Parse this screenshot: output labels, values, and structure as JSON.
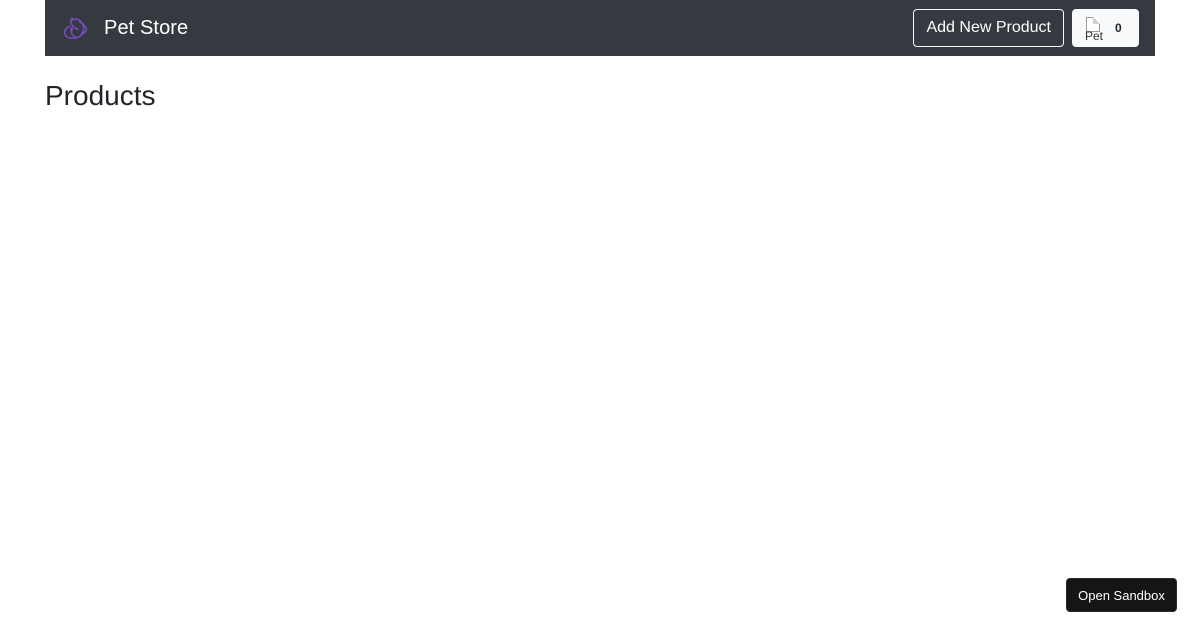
{
  "navbar": {
    "brand_text": "Pet Store",
    "logo_icon": "redux-logo-icon",
    "add_product_label": "Add New Product",
    "cart": {
      "image_alt": "Pet",
      "count": "0"
    }
  },
  "main": {
    "title": "Products"
  },
  "sandbox": {
    "label": "Open Sandbox"
  },
  "colors": {
    "navbar_bg": "#343a40",
    "logo": "#764abc",
    "sandbox_bg": "#151515"
  }
}
